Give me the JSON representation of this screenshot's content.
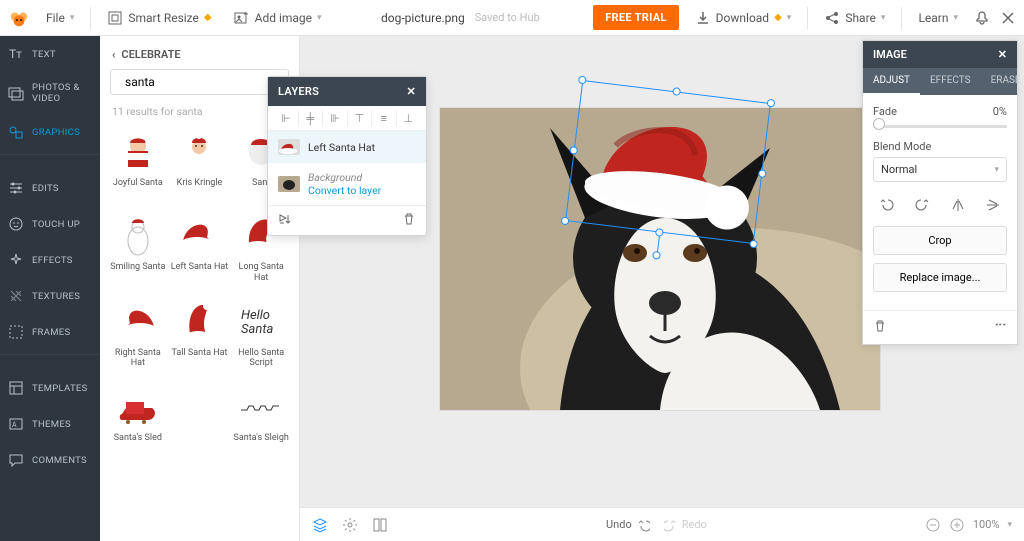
{
  "top": {
    "file": "File",
    "smart_resize": "Smart Resize",
    "add_image": "Add image",
    "filename": "dog-picture.png",
    "saved": "Saved to Hub",
    "free_trial": "FREE TRIAL",
    "download": "Download",
    "share": "Share",
    "learn": "Learn"
  },
  "rail": [
    {
      "label": "TEXT"
    },
    {
      "label": "PHOTOS & VIDEO"
    },
    {
      "label": "GRAPHICS",
      "active": true
    },
    {
      "label": "EDITS"
    },
    {
      "label": "TOUCH UP"
    },
    {
      "label": "EFFECTS"
    },
    {
      "label": "TEXTURES"
    },
    {
      "label": "FRAMES"
    },
    {
      "label": "TEMPLATES"
    },
    {
      "label": "THEMES"
    },
    {
      "label": "COMMENTS"
    }
  ],
  "sidebar": {
    "crumb": "CELEBRATE",
    "search_value": "santa",
    "results_meta": "11 results for santa",
    "items": [
      {
        "label": "Joyful Santa"
      },
      {
        "label": "Kris Kringle"
      },
      {
        "label": "Sant"
      },
      {
        "label": "Smiling Santa"
      },
      {
        "label": "Left Santa Hat"
      },
      {
        "label": "Long Santa Hat"
      },
      {
        "label": "Right Santa Hat"
      },
      {
        "label": "Tall Santa Hat"
      },
      {
        "label": "Hello Santa Script"
      },
      {
        "label": "Santa's Sled"
      },
      {
        "label": ""
      },
      {
        "label": "Santa's Sleigh"
      }
    ]
  },
  "layers": {
    "title": "LAYERS",
    "rows": [
      {
        "name": "Left Santa Hat",
        "selected": true
      },
      {
        "name": "Background",
        "convert": "Convert to layer"
      }
    ]
  },
  "rpanel": {
    "title": "IMAGE",
    "tabs": [
      "ADJUST",
      "EFFECTS",
      "ERASE"
    ],
    "active_tab": 0,
    "fade_label": "Fade",
    "fade_value": "0%",
    "blend_label": "Blend Mode",
    "blend_value": "Normal",
    "crop": "Crop",
    "replace": "Replace image..."
  },
  "bottom": {
    "undo": "Undo",
    "redo": "Redo",
    "zoom": "100%"
  }
}
